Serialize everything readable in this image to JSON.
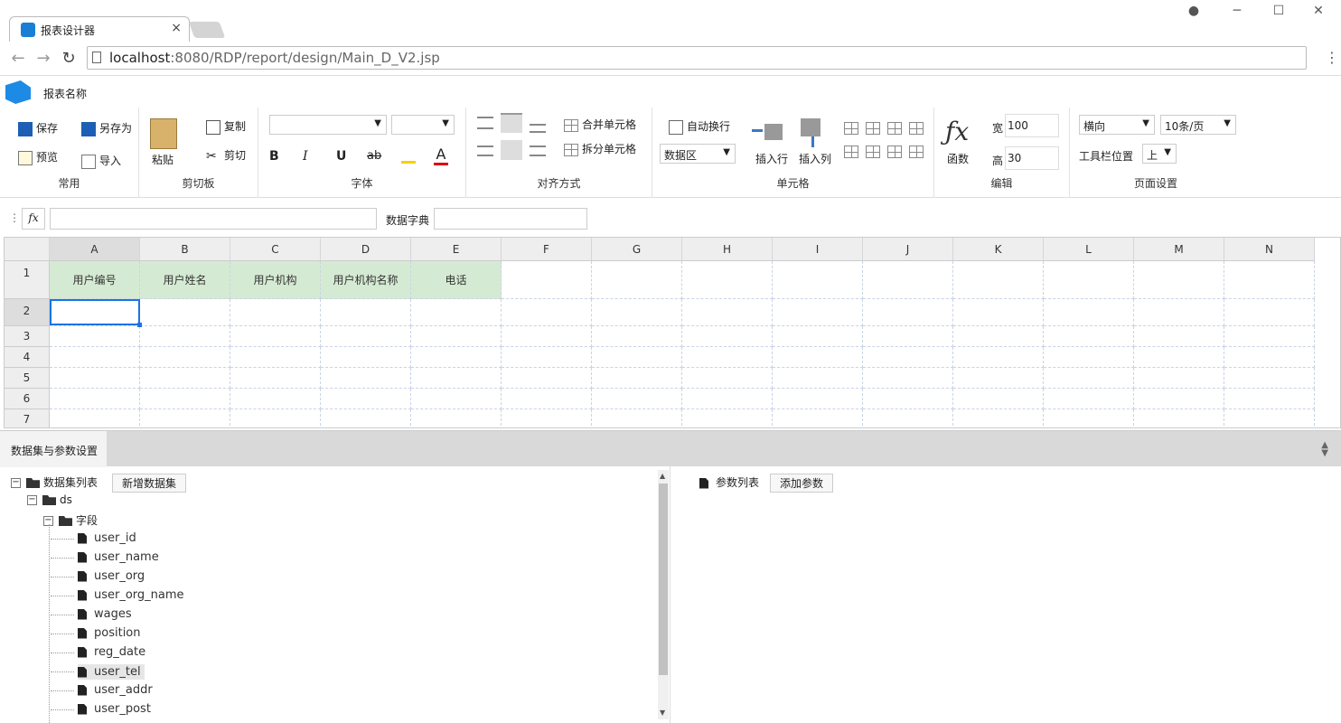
{
  "browser": {
    "tab_title": "报表设计器",
    "url_host": "localhost",
    "url_path": ":8080/RDP/report/design/Main_D_V2.jsp"
  },
  "app": {
    "report_name": "报表名称"
  },
  "ribbon": {
    "common": {
      "save": "保存",
      "save_as": "另存为",
      "preview": "预览",
      "import": "导入",
      "label": "常用"
    },
    "clipboard": {
      "paste": "粘贴",
      "copy": "复制",
      "cut": "剪切",
      "label": "剪切板"
    },
    "font": {
      "bold": "B",
      "italic": "I",
      "underline": "U",
      "strike": "ab",
      "color": "A",
      "label": "字体"
    },
    "align": {
      "merge": "合并单元格",
      "split": "拆分单元格",
      "label": "对齐方式"
    },
    "cell": {
      "wrap": "自动换行",
      "data_area": "数据区",
      "insert_row": "插入行",
      "insert_col": "插入列",
      "label": "单元格"
    },
    "edit": {
      "func": "函数",
      "width_label": "宽",
      "width_value": "100",
      "height_label": "高",
      "height_value": "30",
      "label": "编辑"
    },
    "page": {
      "orientation": "横向",
      "page_size": "10条/页",
      "toolbar_pos_label": "工具栏位置",
      "toolbar_pos": "上",
      "label": "页面设置"
    }
  },
  "formula_bar": {
    "fx": "fx",
    "dict_label": "数据字典"
  },
  "grid": {
    "columns": [
      "A",
      "B",
      "C",
      "D",
      "E",
      "F",
      "G",
      "H",
      "I",
      "J",
      "K",
      "L",
      "M",
      "N"
    ],
    "rows": [
      "1",
      "2",
      "3",
      "4",
      "5",
      "6",
      "7"
    ],
    "header_cells": [
      "用户编号",
      "用户姓名",
      "用户机构",
      "用户机构名称",
      "电话"
    ]
  },
  "panel": {
    "tab": "数据集与参数设置",
    "dataset_list": "数据集列表",
    "add_dataset": "新增数据集",
    "ds": "ds",
    "fields_folder": "字段",
    "fields": [
      "user_id",
      "user_name",
      "user_org",
      "user_org_name",
      "wages",
      "position",
      "reg_date",
      "user_tel",
      "user_addr",
      "user_post"
    ],
    "param_list": "参数列表",
    "add_param": "添加参数"
  }
}
